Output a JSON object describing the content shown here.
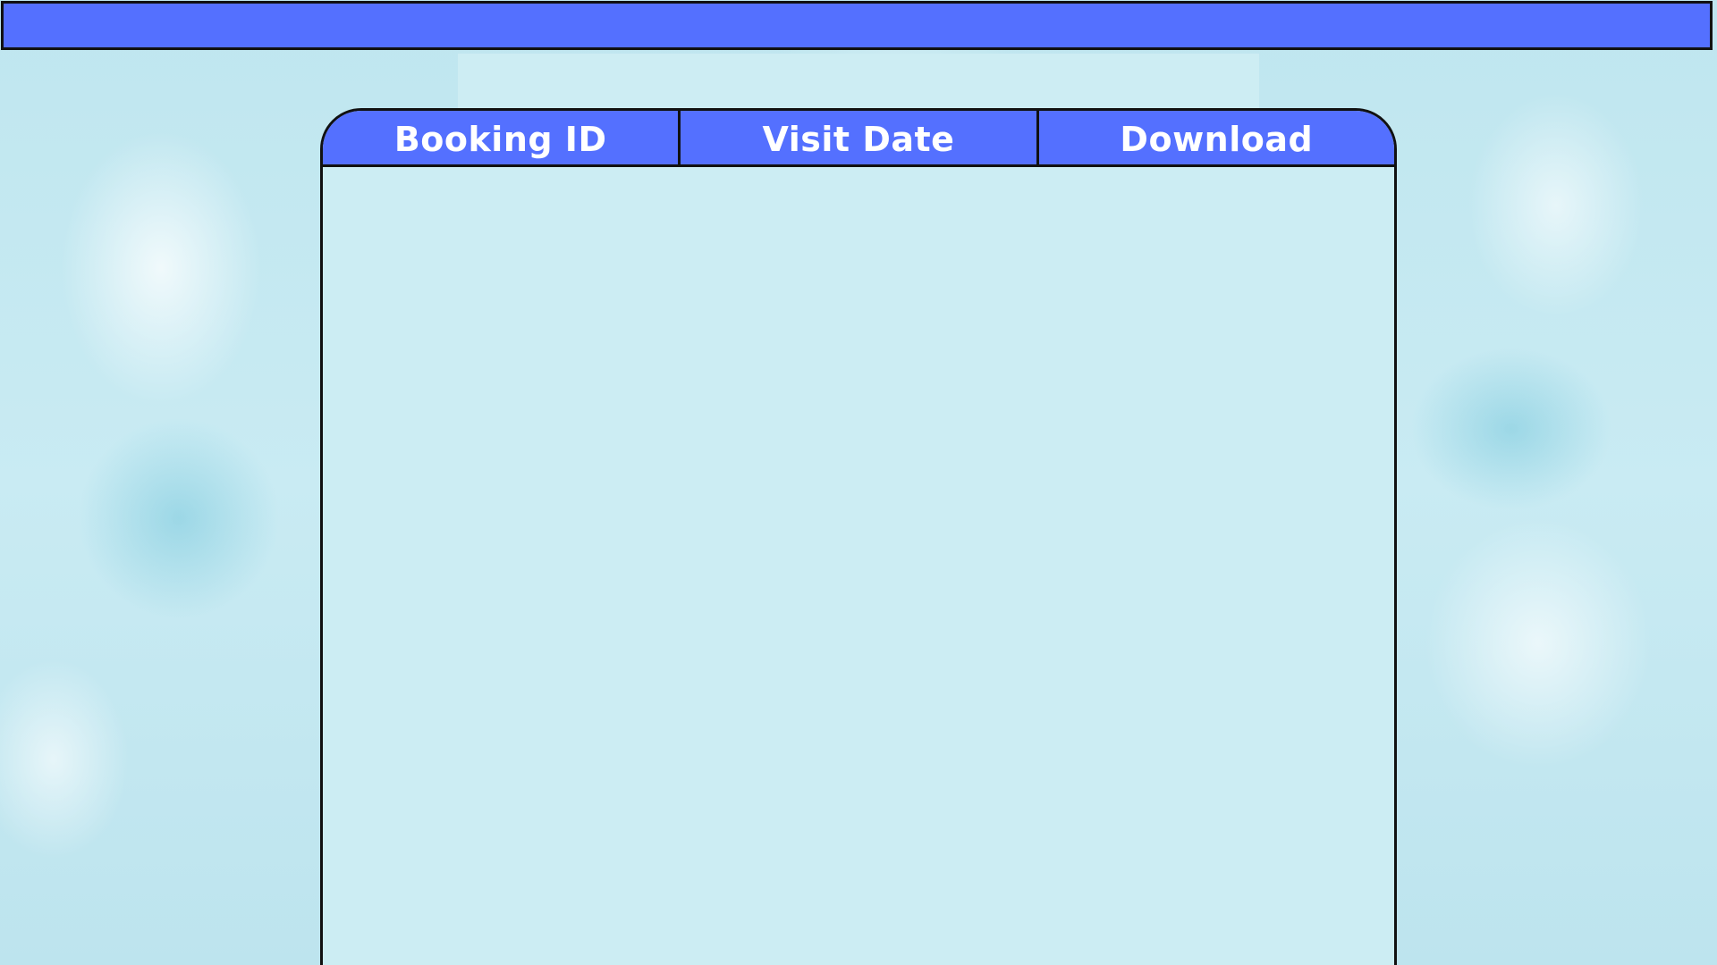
{
  "table": {
    "columns": [
      {
        "label": "Booking ID"
      },
      {
        "label": "Visit Date"
      },
      {
        "label": "Download"
      }
    ],
    "rows": []
  },
  "colors": {
    "accent": "#5470ff",
    "background": "#c7e9f1",
    "panel": "#ccedf3",
    "border": "#111111",
    "header_text": "#ffffff"
  }
}
